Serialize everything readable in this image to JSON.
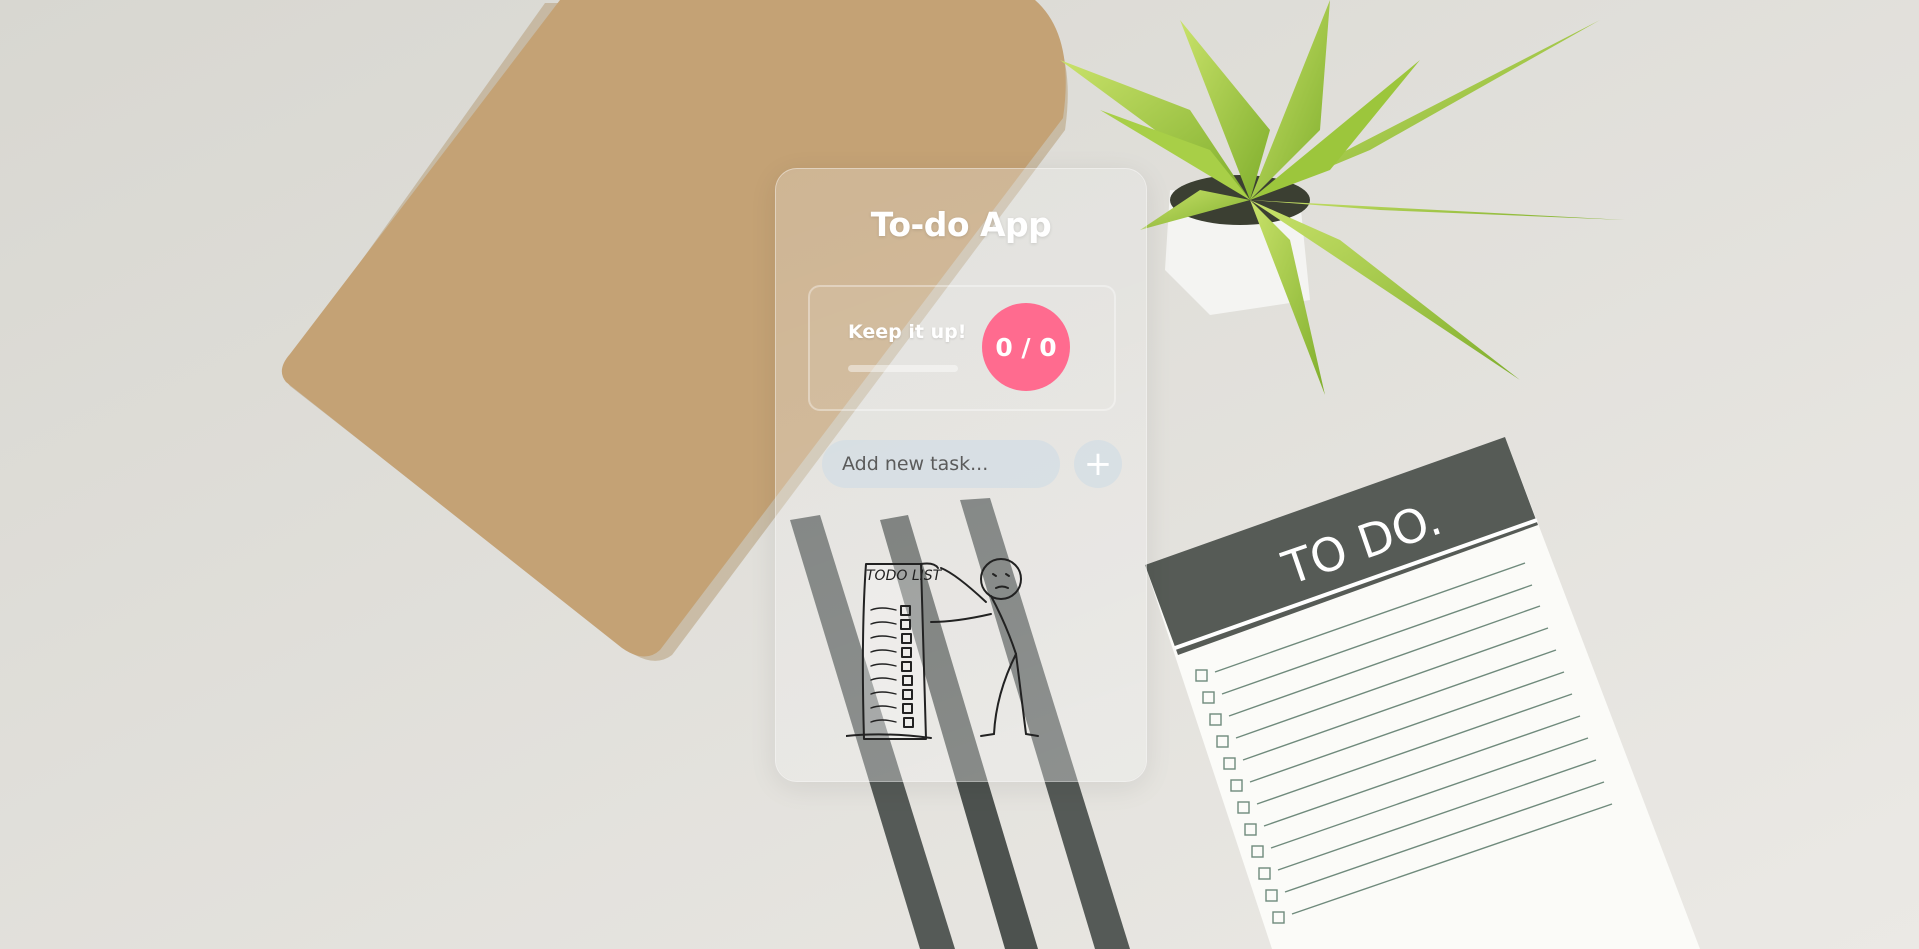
{
  "app": {
    "title": "To-do App"
  },
  "stats": {
    "label": "Keep it up!",
    "counter_text": "0 / 0",
    "progress_fraction": 0
  },
  "task_input": {
    "placeholder": "Add new task...",
    "value": ""
  },
  "add_button": {
    "label": "+"
  },
  "illustration": {
    "list_heading": "TODO LIST",
    "notepad_heading": "TO DO."
  },
  "colors": {
    "accent": "#ff6b8f",
    "card_text": "#ffffff"
  }
}
